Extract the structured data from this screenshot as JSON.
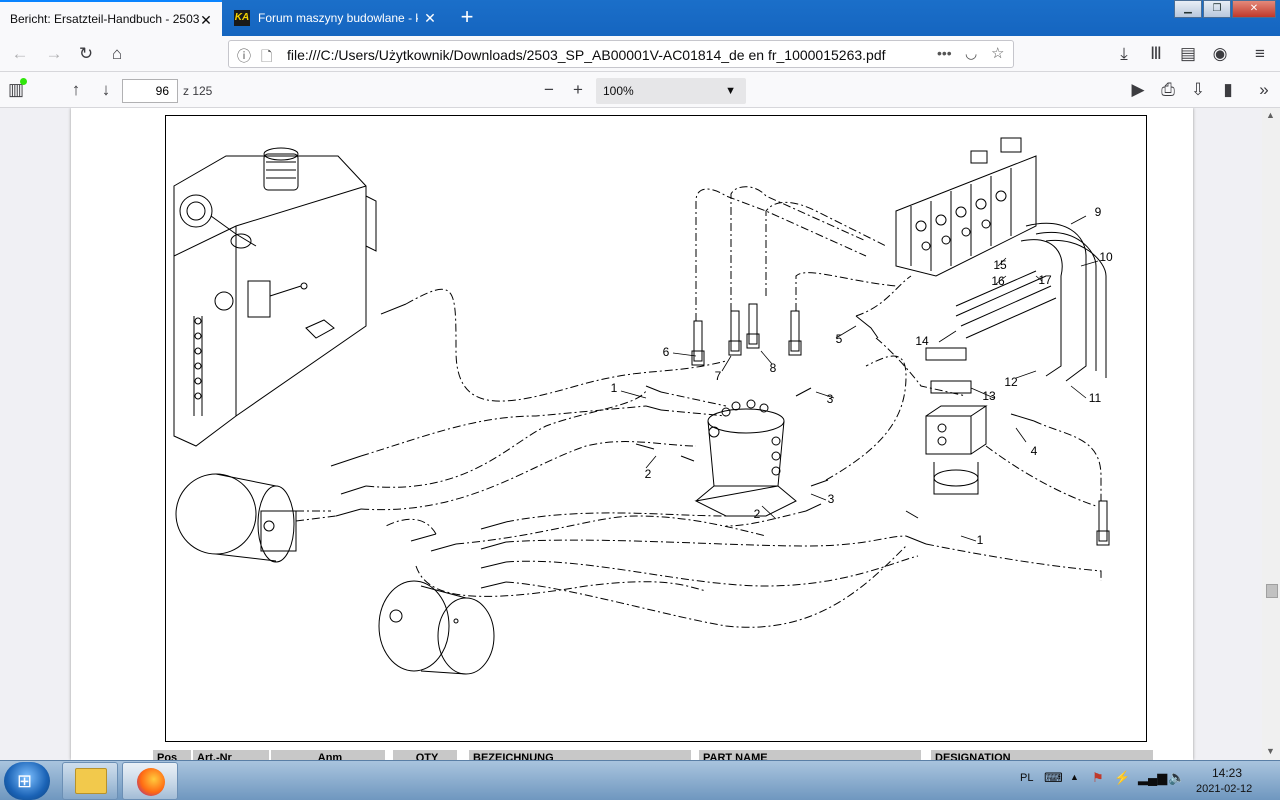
{
  "browser": {
    "tabs": [
      {
        "title": "Bericht: Ersatzteil-Handbuch - 2503",
        "active": true
      },
      {
        "title": "Forum maszyny budowlane - k",
        "active": false,
        "favicon_text": "KA"
      }
    ],
    "url": "file:///C:/Users/Użytkownik/Downloads/2503_SP_AB00001V-AC01814_de en fr_1000015263.pdf",
    "accent_color": "#0a84ff"
  },
  "pdf_toolbar": {
    "page_number": "96",
    "page_count_label": "z 125",
    "zoom": "100%"
  },
  "diagram": {
    "callouts": [
      "1",
      "1",
      "2",
      "2",
      "3",
      "3",
      "4",
      "5",
      "6",
      "7",
      "8",
      "9",
      "10",
      "11",
      "12",
      "13",
      "14",
      "15",
      "16",
      "17"
    ]
  },
  "table_header": {
    "pos": "Pos",
    "art_nr": "Art.-Nr",
    "anm": "Anm",
    "qty": "QTY",
    "bezeichnung": "BEZEICHNUNG",
    "part_name": "PART NAME",
    "designation": "DESIGNATION"
  },
  "taskbar": {
    "language": "PL",
    "time": "14:23",
    "date": "2021-02-12"
  }
}
